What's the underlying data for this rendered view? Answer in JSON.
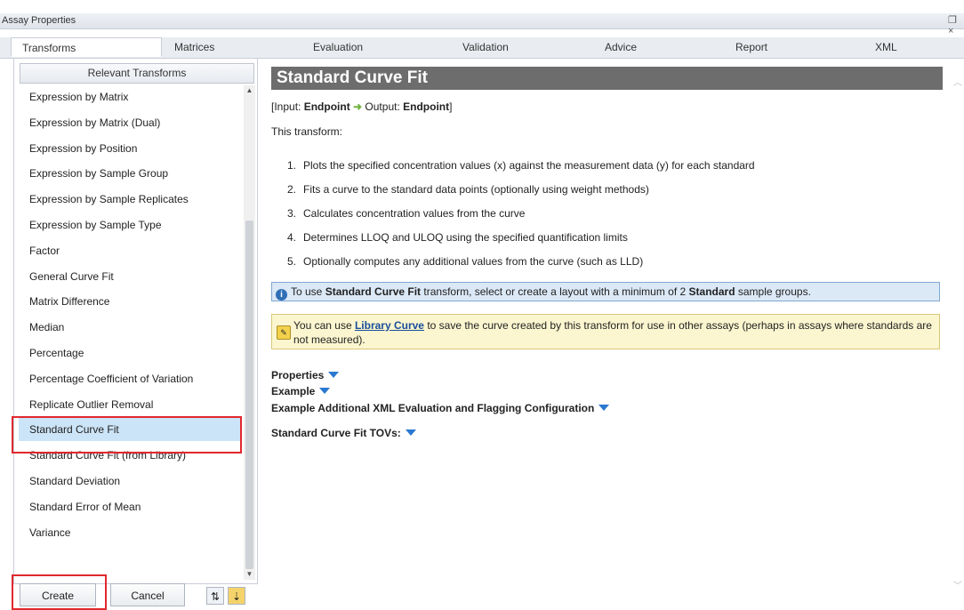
{
  "window": {
    "title": "Assay Properties",
    "controls": "❐ ×"
  },
  "tabs": [
    "Transforms",
    "Matrices",
    "Evaluation",
    "Validation",
    "Advice",
    "Report",
    "XML"
  ],
  "left": {
    "header": "Relevant Transforms",
    "items": [
      "Expression by Matrix",
      "Expression by Matrix (Dual)",
      "Expression by Position",
      "Expression by Sample Group",
      "Expression by Sample Replicates",
      "Expression by Sample Type",
      "Factor",
      "General Curve Fit",
      "Matrix Difference",
      "Median",
      "Percentage",
      "Percentage Coefficient of Variation",
      "Replicate Outlier Removal",
      "Standard Curve Fit",
      "Standard Curve Fit (from Library)",
      "Standard Deviation",
      "Standard Error of Mean",
      "Variance"
    ],
    "selected_index": 13,
    "create_label": "Create",
    "cancel_label": "Cancel"
  },
  "right": {
    "title": "Standard Curve Fit",
    "io": {
      "prefix": "[Input: ",
      "input": "Endpoint",
      "arrow": "➜",
      "mid": " Output: ",
      "output": "Endpoint",
      "suffix": "]"
    },
    "intro": "This transform:",
    "steps": [
      "Plots the specified concentration values (x) against the measurement data (y) for each standard",
      "Fits a curve to the standard data points (optionally using weight methods)",
      "Calculates concentration values from the curve",
      "Determines LLOQ and ULOQ using the specified quantification limits",
      "Optionally computes any additional values from the curve (such as LLD)"
    ],
    "info": {
      "pre": "To use ",
      "b1": "Standard Curve Fit",
      "mid": " transform, select or create a layout with a minimum of 2 ",
      "b2": "Standard",
      "post": " sample groups."
    },
    "note": {
      "pre": "You can use ",
      "link": "Library Curve",
      "post": " to save the curve created by this transform for use in other assays (perhaps in assays where standards are not measured)."
    },
    "sections": [
      "Properties",
      "Example",
      "Example Additional XML Evaluation and Flagging Configuration",
      "Standard Curve Fit TOVs:"
    ]
  }
}
